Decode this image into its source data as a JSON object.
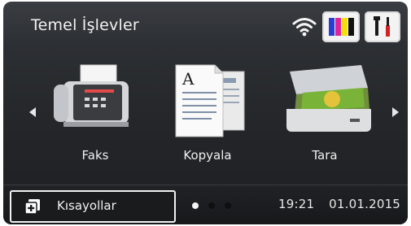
{
  "header": {
    "title": "Temel İşlevler",
    "wifi_icon": "wifi-icon",
    "ink_icon": "ink-levels-icon",
    "settings_icon": "settings-tools-icon",
    "ink_colors": [
      "#2b3cd4",
      "#e0239b",
      "#f5dd10",
      "#111111"
    ]
  },
  "apps": [
    {
      "label": "Faks",
      "icon": "fax-icon"
    },
    {
      "label": "Kopyala",
      "icon": "copy-icon"
    },
    {
      "label": "Tara",
      "icon": "scan-icon"
    }
  ],
  "bottom": {
    "shortcut_label": "Kısayollar",
    "shortcut_icon": "shortcut-add-icon",
    "page_indicator": {
      "pages": 3,
      "active": 1
    },
    "time": "19:21",
    "date": "01.01.2015"
  }
}
